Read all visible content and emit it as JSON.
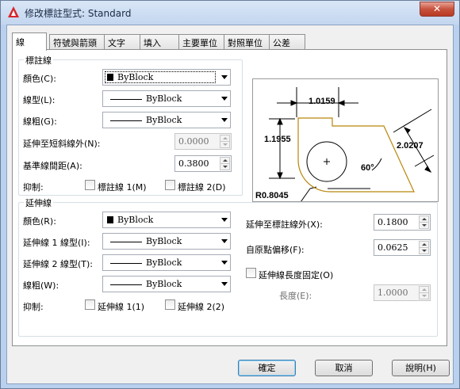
{
  "window": {
    "title": "修改標註型式: Standard",
    "close_symbol": "✕"
  },
  "tabs": [
    {
      "label": "線"
    },
    {
      "label": "符號與箭頭"
    },
    {
      "label": "文字"
    },
    {
      "label": "填入"
    },
    {
      "label": "主要單位"
    },
    {
      "label": "對照單位"
    },
    {
      "label": "公差"
    }
  ],
  "dim_lines": {
    "title": "標註線",
    "color_label": "顏色(C):",
    "color_value": "ByBlock",
    "linetype_label": "線型(L):",
    "linetype_value": "ByBlock",
    "lineweight_label": "線粗(G):",
    "lineweight_value": "ByBlock",
    "extend_ticks_label": "延伸至短斜線外(N):",
    "extend_ticks_value": "0.0000",
    "baseline_spacing_label": "基準線間距(A):",
    "baseline_spacing_value": "0.3800",
    "suppress_label": "抑制:",
    "suppress_1": "標註線 1(M)",
    "suppress_2": "標註線 2(D)"
  },
  "ext_lines": {
    "title": "延伸線",
    "color_label": "顏色(R):",
    "color_value": "ByBlock",
    "linetype1_label": "延伸線 1 線型(I):",
    "linetype1_value": "ByBlock",
    "linetype2_label": "延伸線 2 線型(T):",
    "linetype2_value": "ByBlock",
    "lineweight_label": "線粗(W):",
    "lineweight_value": "ByBlock",
    "suppress_label": "抑制:",
    "suppress_1": "延伸線 1(1)",
    "suppress_2": "延伸線 2(2)",
    "extend_label": "延伸至標註線外(X):",
    "extend_value": "0.1800",
    "offset_label": "自原點偏移(F):",
    "offset_value": "0.0625",
    "fixed_label": "延伸線長度固定(O)",
    "length_label": "長度(E):",
    "length_value": "1.0000"
  },
  "preview": {
    "dim_top": "1.0159",
    "dim_left": "1.1955",
    "dim_right": "2.0207",
    "angle": "60°",
    "radius": "R0.8045",
    "colors": {
      "part": "#b8860b"
    }
  },
  "buttons": {
    "ok": "確定",
    "cancel": "取消",
    "help": "說明(H)"
  },
  "colors": {
    "title_bg": "#c3d6ef",
    "close_red": "#c7523d"
  }
}
